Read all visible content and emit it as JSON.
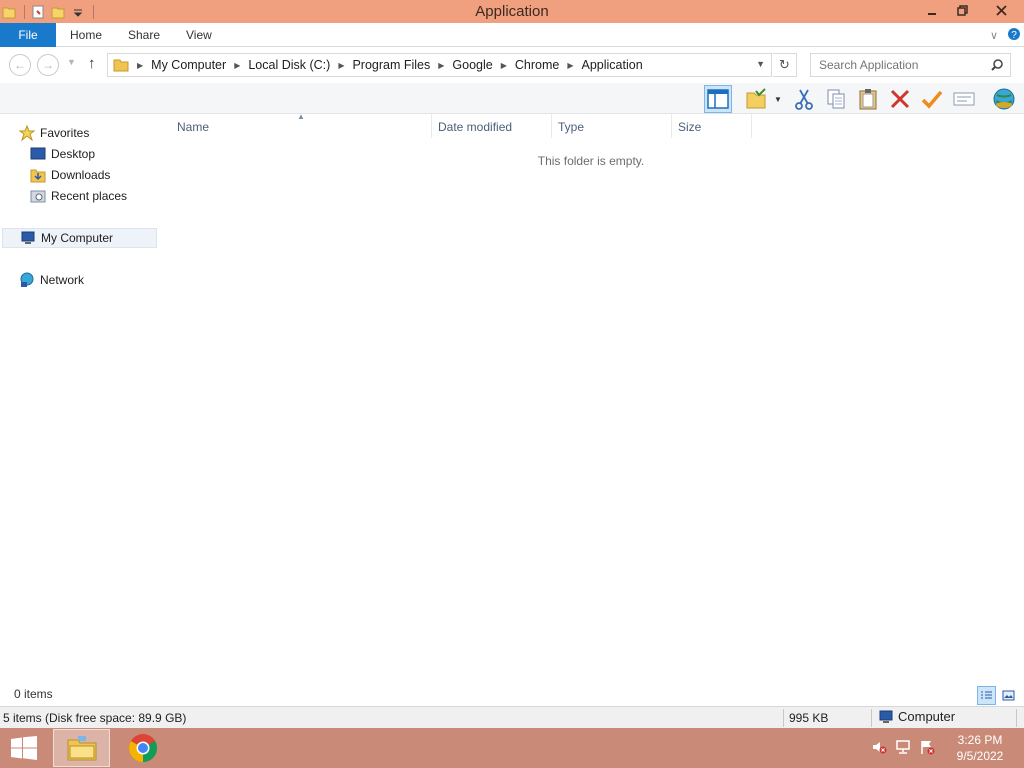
{
  "window": {
    "title": "Application"
  },
  "ribbon": {
    "tabs": [
      "File",
      "Home",
      "Share",
      "View"
    ]
  },
  "address": {
    "crumbs": [
      "My Computer",
      "Local Disk (C:)",
      "Program Files",
      "Google",
      "Chrome",
      "Application"
    ]
  },
  "search": {
    "placeholder": "Search Application"
  },
  "nav": {
    "favorites": "Favorites",
    "desktop": "Desktop",
    "downloads": "Downloads",
    "recent": "Recent places",
    "computer": "My Computer",
    "network": "Network"
  },
  "columns": {
    "name": "Name",
    "date": "Date modified",
    "type": "Type",
    "size": "Size"
  },
  "content": {
    "empty_message": "This folder is empty."
  },
  "countbar": {
    "items": "0 items"
  },
  "status": {
    "left": "5 items (Disk free space: 89.9 GB)",
    "size": "995 KB",
    "zone": "Computer"
  },
  "clock": {
    "time": "3:26 PM",
    "date": "9/5/2022"
  },
  "colors": {
    "titlebar": "#f1a07f",
    "file_tab": "#1979ca",
    "taskbar": "#c98a78"
  }
}
